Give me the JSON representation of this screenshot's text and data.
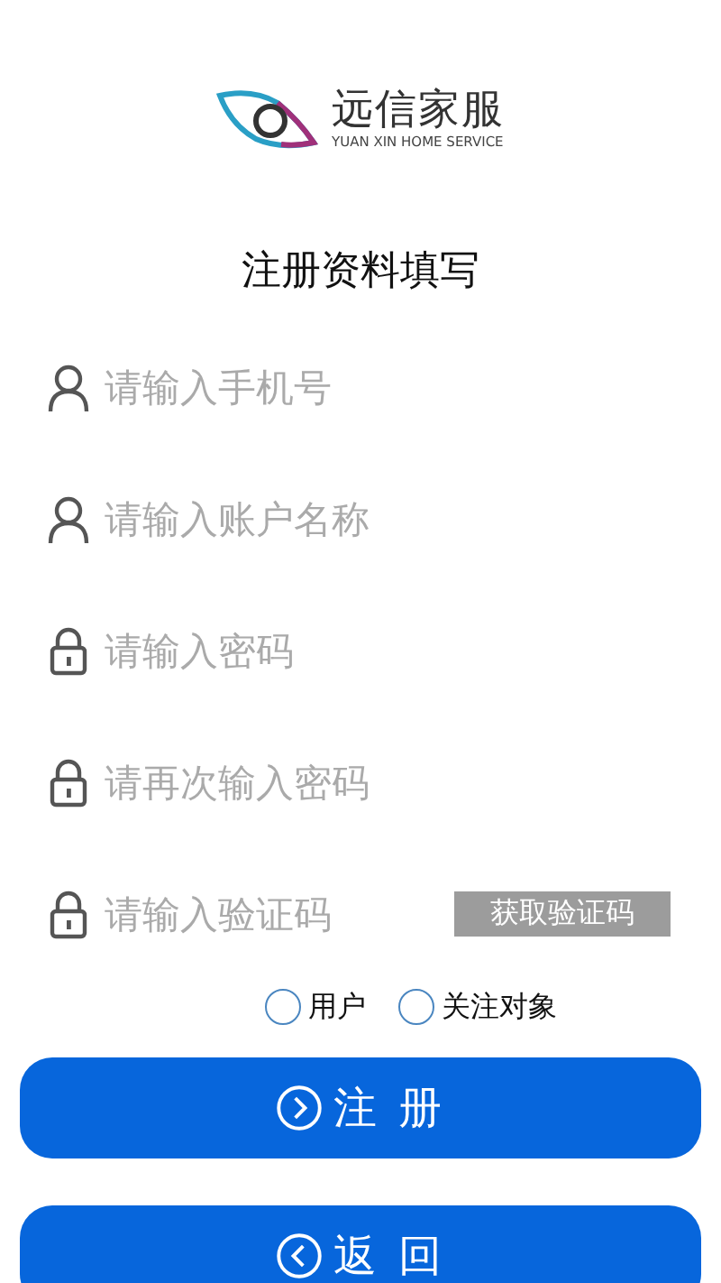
{
  "logo": {
    "name": "远信家服",
    "tagline": "YUAN XIN HOME SERVICE"
  },
  "title": "注册资料填写",
  "fields": [
    {
      "kind": "user",
      "placeholder": "请输入手机号"
    },
    {
      "kind": "user",
      "placeholder": "请输入账户名称"
    },
    {
      "kind": "lock",
      "placeholder": "请输入密码"
    },
    {
      "kind": "lock",
      "placeholder": "请再次输入密码"
    },
    {
      "kind": "lock",
      "placeholder": "请输入验证码",
      "button": "获取验证码"
    }
  ],
  "roles": [
    {
      "label": "用户",
      "selected": false
    },
    {
      "label": "关注对象",
      "selected": false
    }
  ],
  "buttons": [
    {
      "kind": "next",
      "label": "注 册"
    },
    {
      "kind": "back",
      "label": "返 回"
    }
  ]
}
